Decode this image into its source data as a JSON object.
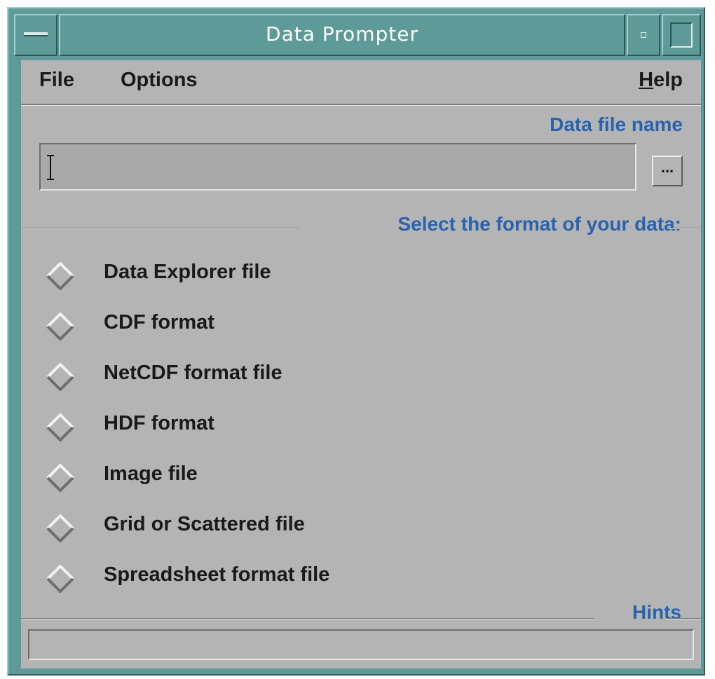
{
  "window": {
    "title": "Data Prompter"
  },
  "menubar": {
    "file": "File",
    "options": "Options",
    "help_first": "H",
    "help_rest": "elp"
  },
  "data_file": {
    "label": "Data file name",
    "value": "",
    "browse_label": "..."
  },
  "format": {
    "label": "Select the format of your data:",
    "options": [
      "Data Explorer file",
      "CDF format",
      "NetCDF format file",
      "HDF format",
      "Image file",
      "Grid or Scattered file",
      "Spreadsheet format file"
    ]
  },
  "hints": {
    "label": "Hints",
    "text": ""
  },
  "colors": {
    "frame": "#5e9a98",
    "client": "#b4b4b4",
    "accent_label": "#2a63ad"
  },
  "icons": {
    "window_menu": "window-menu-icon",
    "minimize": "minimize-icon",
    "maximize": "maximize-icon",
    "radio": "diamond-radio-icon",
    "text_cursor": "ibeam-cursor-icon"
  }
}
